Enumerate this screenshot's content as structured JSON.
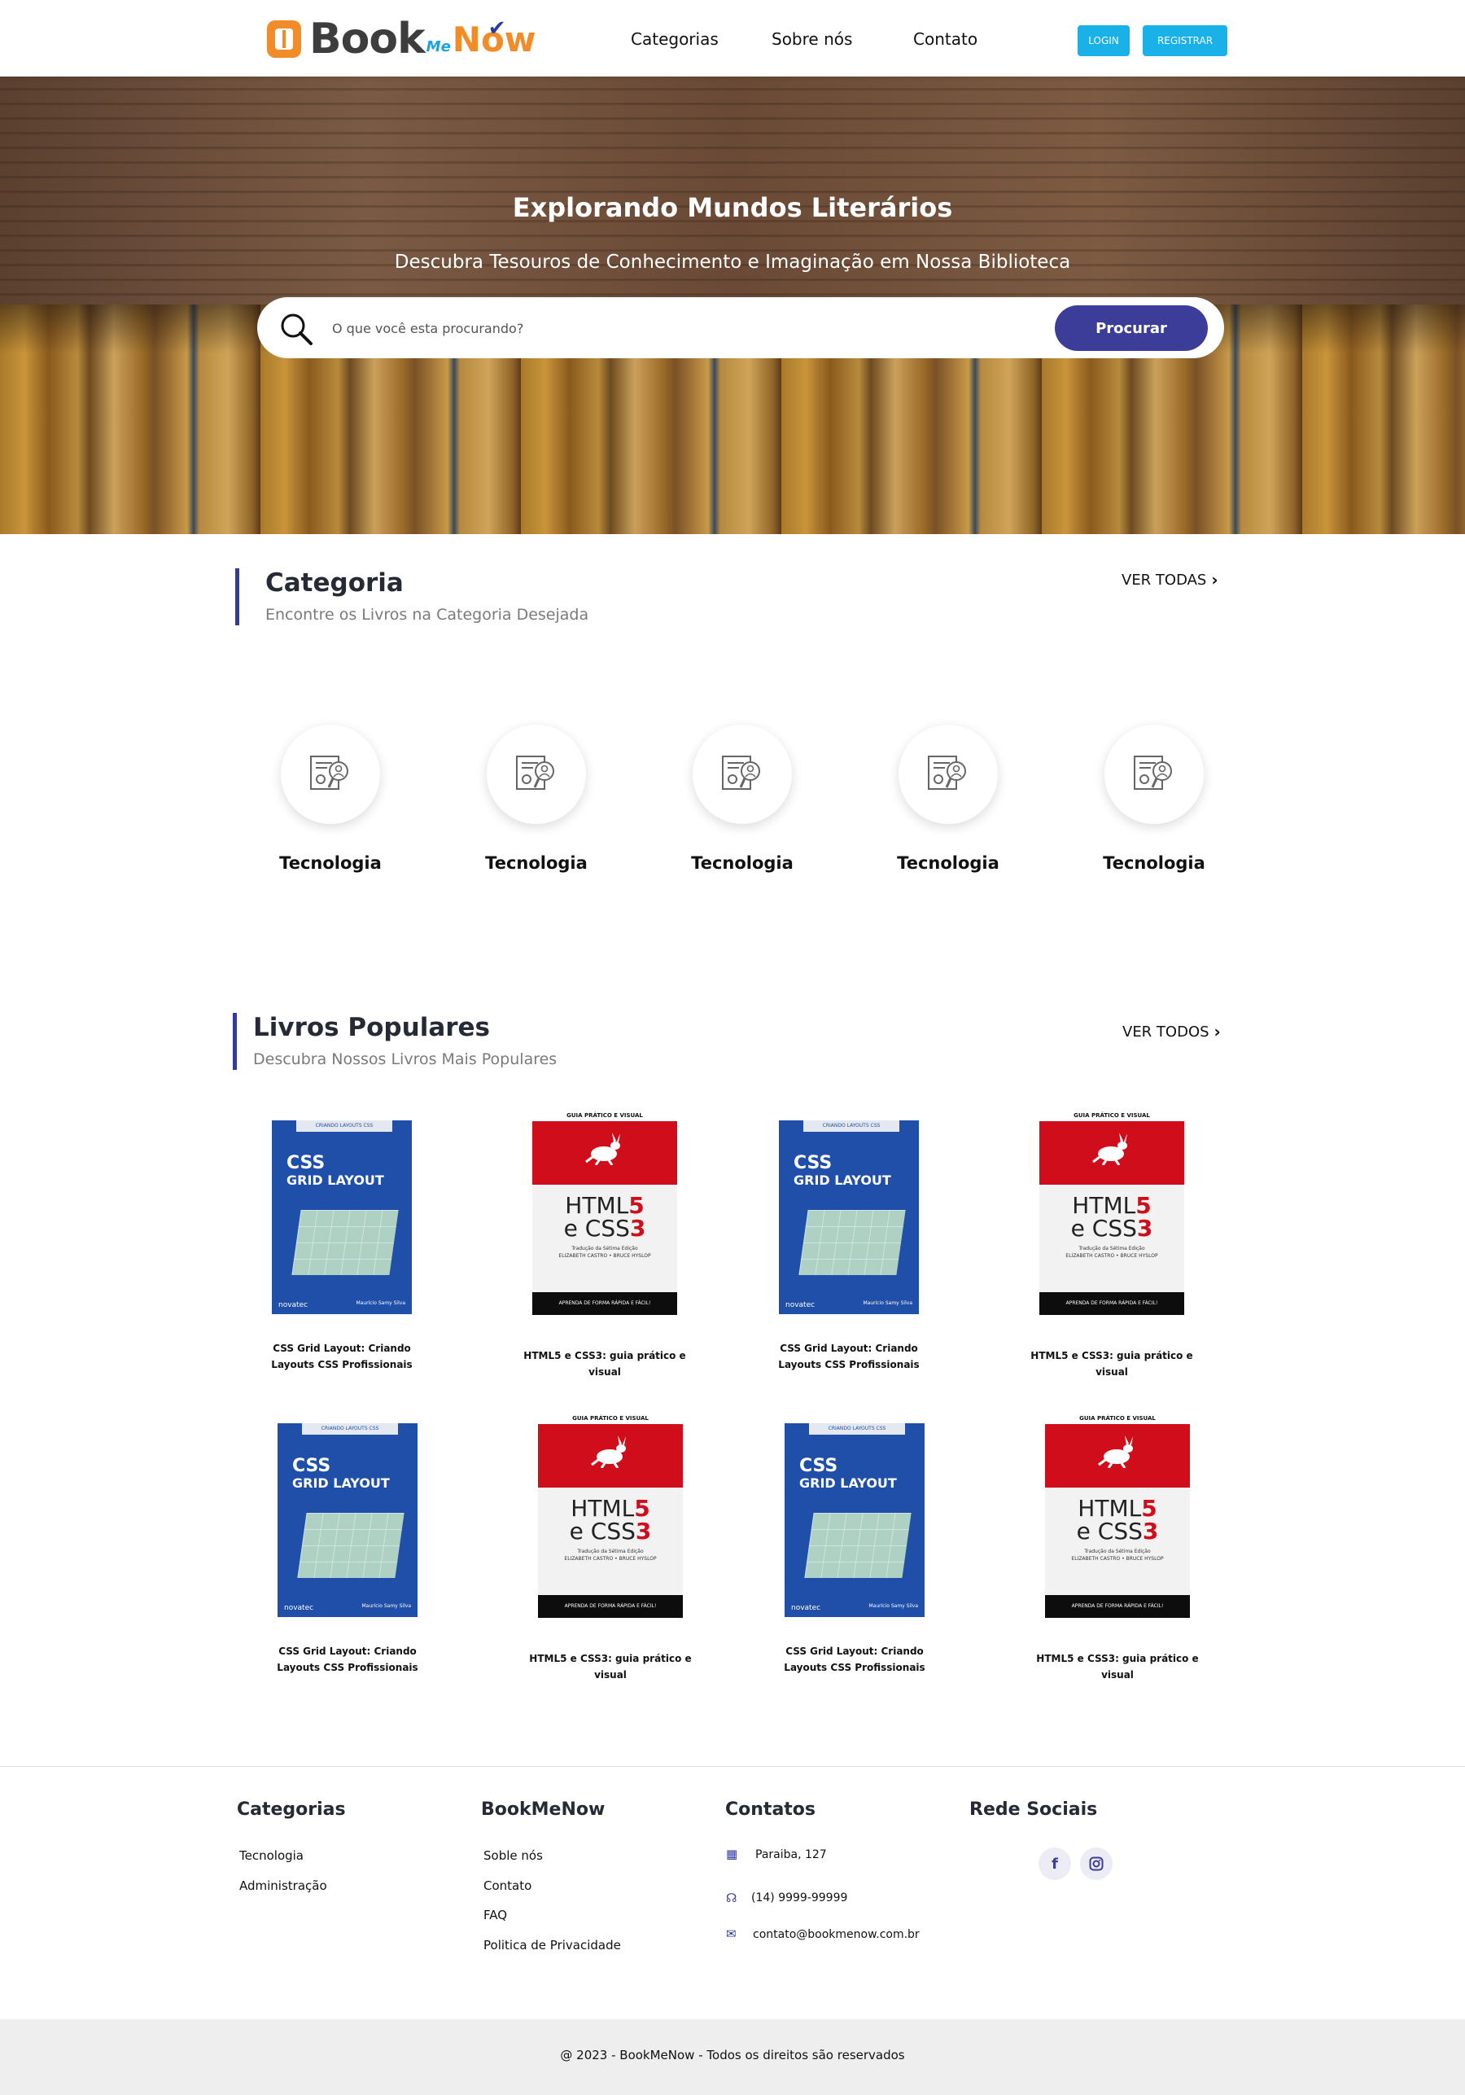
{
  "brand": {
    "book": "Book",
    "me": "Me",
    "now": "Now"
  },
  "nav": [
    {
      "label": "Categorias"
    },
    {
      "label": "Sobre nós"
    },
    {
      "label": "Contato"
    }
  ],
  "auth": {
    "login": "LOGIN",
    "register": "REGISTRAR"
  },
  "hero": {
    "title": "Explorando Mundos Literários",
    "subtitle": "Descubra Tesouros de Conhecimento e Imaginação em Nossa Biblioteca",
    "search_placeholder": "O que você esta procurando?",
    "search_button": "Procurar"
  },
  "categories_section": {
    "title": "Categoria",
    "subtitle": "Encontre os Livros na Categoria Desejada",
    "see_all": "VER TODAS",
    "items": [
      {
        "label": "Tecnologia"
      },
      {
        "label": "Tecnologia"
      },
      {
        "label": "Tecnologia"
      },
      {
        "label": "Tecnologia"
      },
      {
        "label": "Tecnologia"
      }
    ]
  },
  "popular_section": {
    "title": "Livros Populares",
    "subtitle": "Descubra Nossos Livros Mais Populares",
    "see_all": "VER TODOS",
    "books": [
      {
        "title": "CSS Grid Layout: Criando Layouts CSS Profissionais",
        "cover": "css"
      },
      {
        "title": "HTML5 e CSS3: guia prático e visual",
        "cover": "html"
      },
      {
        "title": "CSS Grid Layout: Criando Layouts CSS Profissionais",
        "cover": "css"
      },
      {
        "title": "HTML5 e CSS3: guia prático e visual",
        "cover": "html"
      },
      {
        "title": "CSS Grid Layout: Criando Layouts CSS Profissionais",
        "cover": "css"
      },
      {
        "title": "HTML5 e CSS3: guia prático e visual",
        "cover": "html"
      },
      {
        "title": "CSS Grid Layout: Criando Layouts CSS Profissionais",
        "cover": "css"
      },
      {
        "title": "HTML5 e CSS3: guia prático e visual",
        "cover": "html"
      }
    ]
  },
  "covers": {
    "css": {
      "band": "CRIANDO LAYOUTS CSS PROFISSIONAIS",
      "line1": "CSS",
      "line2": "GRID LAYOUT",
      "publisher": "novatec",
      "author": "Maurício Samy Silva"
    },
    "html": {
      "band": "GUIA PRÁTICO E VISUAL",
      "line1a": "HTML",
      "line1b": "5",
      "line2a": "e CSS",
      "line2b": "3",
      "edition": "Tradução da Sétima Edição",
      "authors": "ELIZABETH CASTRO • BRUCE HYSLOP",
      "bottom": "APRENDA DE FORMA RÁPIDA E FÁCIL!"
    }
  },
  "footer": {
    "categorias": {
      "title": "Categorias",
      "links": [
        "Tecnologia",
        "Administração"
      ]
    },
    "bookmenow": {
      "title": "BookMeNow",
      "links": [
        "Soble nós",
        "Contato",
        "FAQ",
        "Politica de Privacidade"
      ]
    },
    "contatos": {
      "title": "Contatos",
      "address": "Paraiba, 127",
      "phone": "(14) 9999-99999",
      "email": "contato@bookmenow.com.br"
    },
    "social": {
      "title": "Rede Sociais",
      "icons": [
        "facebook-icon",
        "instagram-icon"
      ]
    },
    "copyright": "@ 2023 - BookMeNow - Todos os direitos são reservados"
  },
  "colors": {
    "primary": "#3b3d99",
    "accent": "#1ab0e8",
    "brand_orange": "#f28c28"
  }
}
